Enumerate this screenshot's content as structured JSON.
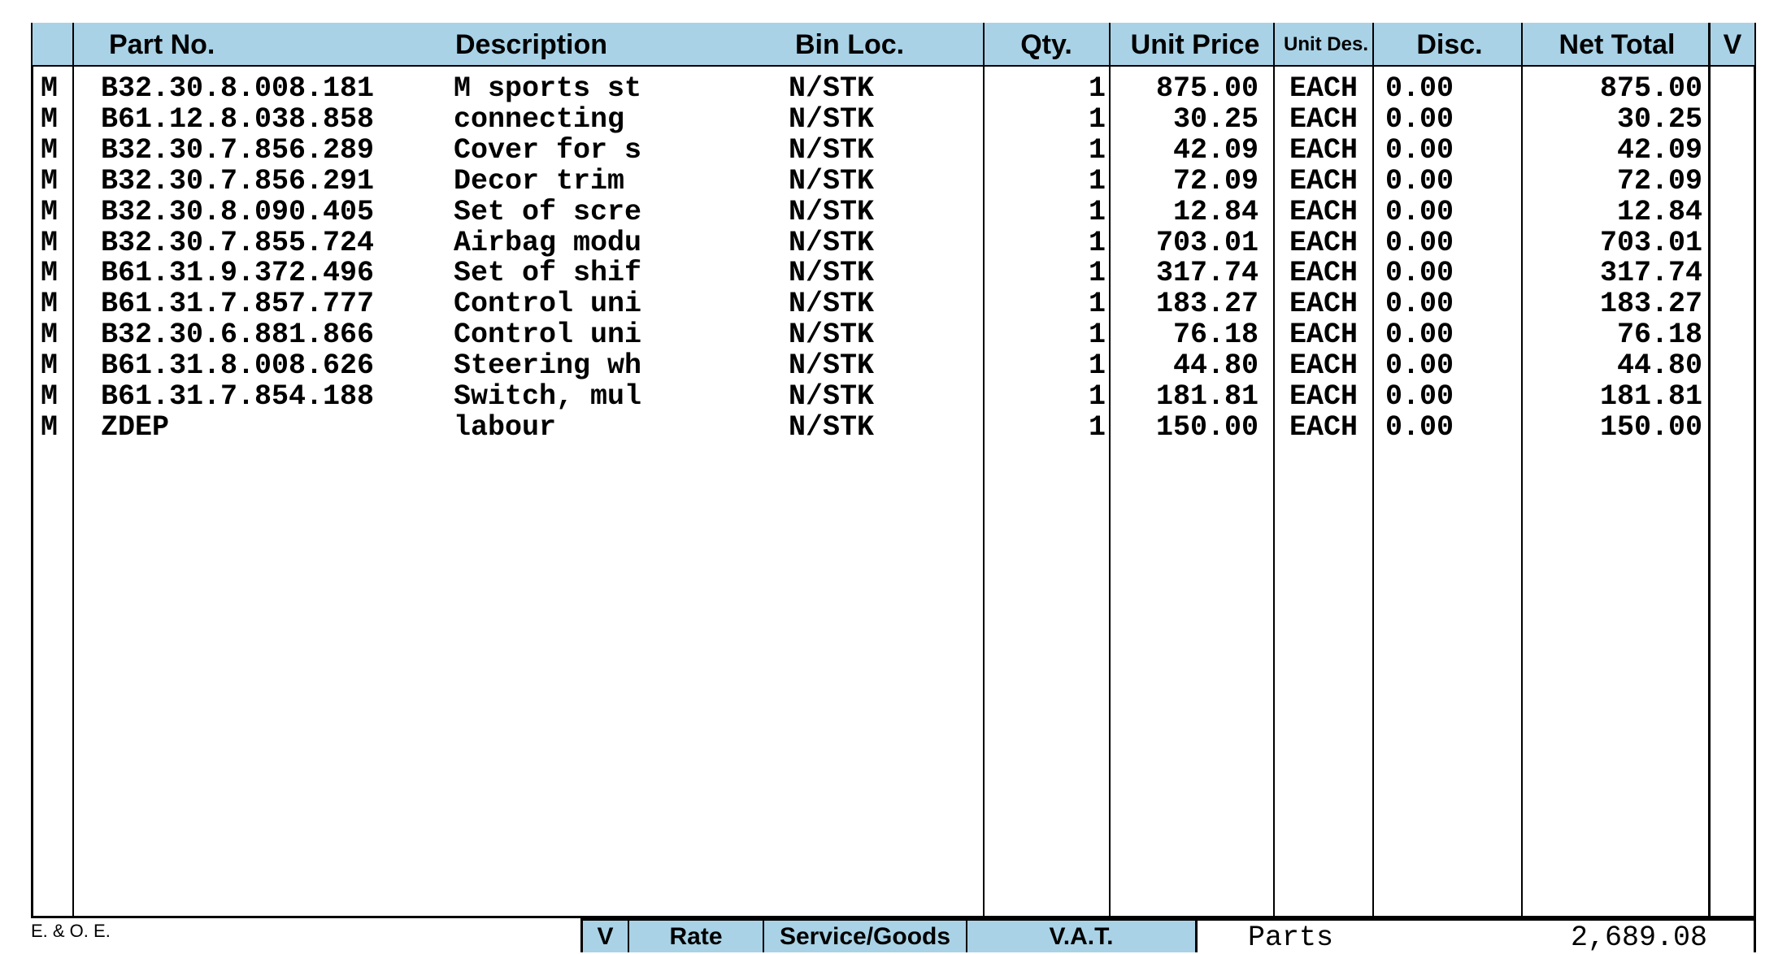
{
  "colors": {
    "header_bg": "#a9d2e6",
    "border": "#000000"
  },
  "headers": {
    "part_no": "Part No.",
    "description": "Description",
    "bin_loc": "Bin Loc.",
    "qty": "Qty.",
    "unit_price": "Unit Price",
    "unit_des": "Unit Des.",
    "disc": "Disc.",
    "net_total": "Net Total",
    "v": "V"
  },
  "rows": [
    {
      "flag": "M",
      "part_no": "B32.30.8.008.181",
      "description": "M sports st",
      "bin_loc": "N/STK",
      "qty": "1",
      "unit_price": "875.00",
      "unit_des": "EACH",
      "disc": "0.00",
      "net_total": "875.00"
    },
    {
      "flag": "M",
      "part_no": "B61.12.8.038.858",
      "description": "connecting",
      "bin_loc": "N/STK",
      "qty": "1",
      "unit_price": "30.25",
      "unit_des": "EACH",
      "disc": "0.00",
      "net_total": "30.25"
    },
    {
      "flag": "M",
      "part_no": "B32.30.7.856.289",
      "description": "Cover for s",
      "bin_loc": "N/STK",
      "qty": "1",
      "unit_price": "42.09",
      "unit_des": "EACH",
      "disc": "0.00",
      "net_total": "42.09"
    },
    {
      "flag": "M",
      "part_no": "B32.30.7.856.291",
      "description": "Decor trim",
      "bin_loc": "N/STK",
      "qty": "1",
      "unit_price": "72.09",
      "unit_des": "EACH",
      "disc": "0.00",
      "net_total": "72.09"
    },
    {
      "flag": "M",
      "part_no": "B32.30.8.090.405",
      "description": "Set of scre",
      "bin_loc": "N/STK",
      "qty": "1",
      "unit_price": "12.84",
      "unit_des": "EACH",
      "disc": "0.00",
      "net_total": "12.84"
    },
    {
      "flag": "M",
      "part_no": "B32.30.7.855.724",
      "description": "Airbag modu",
      "bin_loc": "N/STK",
      "qty": "1",
      "unit_price": "703.01",
      "unit_des": "EACH",
      "disc": "0.00",
      "net_total": "703.01"
    },
    {
      "flag": "M",
      "part_no": "B61.31.9.372.496",
      "description": "Set of shif",
      "bin_loc": "N/STK",
      "qty": "1",
      "unit_price": "317.74",
      "unit_des": "EACH",
      "disc": "0.00",
      "net_total": "317.74"
    },
    {
      "flag": "M",
      "part_no": "B61.31.7.857.777",
      "description": "Control uni",
      "bin_loc": "N/STK",
      "qty": "1",
      "unit_price": "183.27",
      "unit_des": "EACH",
      "disc": "0.00",
      "net_total": "183.27"
    },
    {
      "flag": "M",
      "part_no": "B32.30.6.881.866",
      "description": "Control uni",
      "bin_loc": "N/STK",
      "qty": "1",
      "unit_price": "76.18",
      "unit_des": "EACH",
      "disc": "0.00",
      "net_total": "76.18"
    },
    {
      "flag": "M",
      "part_no": "B61.31.8.008.626",
      "description": "Steering wh",
      "bin_loc": "N/STK",
      "qty": "1",
      "unit_price": "44.80",
      "unit_des": "EACH",
      "disc": "0.00",
      "net_total": "44.80"
    },
    {
      "flag": "M",
      "part_no": "B61.31.7.854.188",
      "description": "Switch, mul",
      "bin_loc": "N/STK",
      "qty": "1",
      "unit_price": "181.81",
      "unit_des": "EACH",
      "disc": "0.00",
      "net_total": "181.81"
    },
    {
      "flag": "M",
      "part_no": "ZDEP",
      "description": "labour",
      "bin_loc": "N/STK",
      "qty": "1",
      "unit_price": "150.00",
      "unit_des": "EACH",
      "disc": "0.00",
      "net_total": "150.00"
    }
  ],
  "footer": {
    "eoe": "E. & O. E.",
    "v": "V",
    "rate": "Rate",
    "service_goods": "Service/Goods",
    "vat": "V.A.T.",
    "parts_label": "Parts",
    "parts_total": "2,689.08"
  }
}
